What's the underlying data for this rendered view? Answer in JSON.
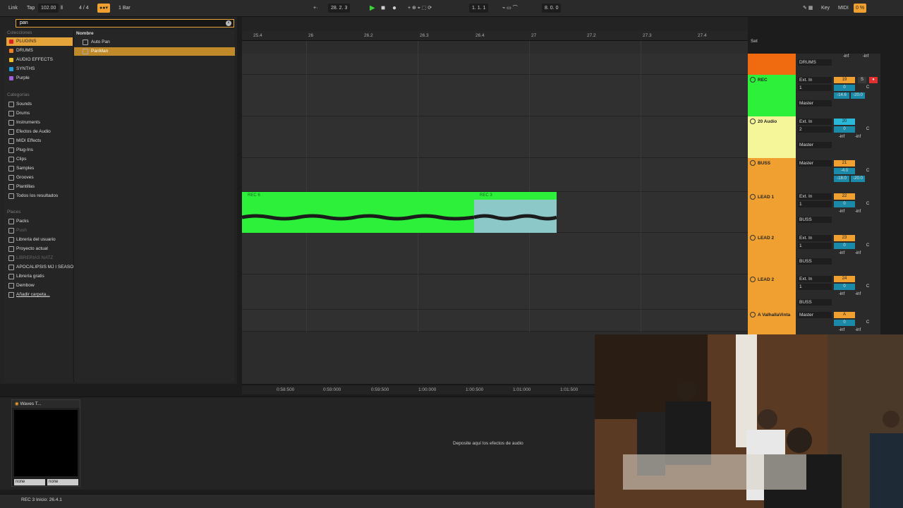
{
  "topbar": {
    "link": "Link",
    "tap": "Tap",
    "tempo": "102.00",
    "signature": "4 / 4",
    "quantize": "1 Bar",
    "position": "28.  2.  3",
    "loop_start": "1.  1.  1",
    "loop_length": "8.  0.  0",
    "key": "Key",
    "midi": "MIDI",
    "cpu": "0 %"
  },
  "browser": {
    "search": "pan",
    "collections_header": "Colecciones",
    "collections": [
      {
        "label": "PLUGINS",
        "color": "#e02020"
      },
      {
        "label": "DRUMS",
        "color": "#f08020"
      },
      {
        "label": "AUDIO EFFECTS",
        "color": "#f0c020"
      },
      {
        "label": "SYNTHS",
        "color": "#20a0e0"
      },
      {
        "label": "Purple",
        "color": "#a060e0"
      }
    ],
    "categories_header": "Categorías",
    "categories": [
      "Sounds",
      "Drums",
      "Instruments",
      "Efectos de Audio",
      "MIDI Effects",
      "Plug-Ins",
      "Clips",
      "Samples",
      "Grooves",
      "Plantillas",
      "Todos los resultados"
    ],
    "places_header": "Places",
    "places": [
      "Packs",
      "Push",
      "Librería del usuario",
      "Proyecto actual",
      "LIBRERIAS NATZ",
      "APOCALIPSIS MJ I SEASO",
      "Librería gratis",
      "Dembow",
      "Añadir carpeta..."
    ],
    "list_header": "Nombre",
    "items": [
      "Auto Pan",
      "PanMan"
    ]
  },
  "ruler": [
    "25.4",
    "26",
    "26.2",
    "26.3",
    "26.4",
    "27",
    "27.2",
    "27.3",
    "27.4"
  ],
  "set_label": "Set",
  "timeline": [
    "0:58:500",
    "0:59:000",
    "0:59:500",
    "1:00:000",
    "1:00:500",
    "1:01:000",
    "1:01:500"
  ],
  "clips": {
    "a": "REC 6",
    "b": "REC 3"
  },
  "tracks": [
    {
      "name": "",
      "color": "#f06a10",
      "in": "Ext. In",
      "ch": "",
      "out": "DRUMS",
      "num": "",
      "vol": "",
      "pan": "",
      "c": "-inf",
      "d": "-inf"
    },
    {
      "name": "REC",
      "color": "#2cf03a",
      "in": "Ext. In",
      "ch": "1",
      "out": "Master",
      "num": "19",
      "vol": "0",
      "pan": "C",
      "c": "-14.6",
      "d": "-20.0"
    },
    {
      "name": "20 Audio",
      "color": "#f5f59a",
      "in": "Ext. In",
      "ch": "2",
      "out": "Master",
      "num": "20",
      "vol": "0",
      "pan": "C",
      "c": "-inf",
      "d": "-inf"
    },
    {
      "name": "BUSS",
      "color": "#f0a030",
      "in": "Master",
      "ch": "",
      "out": "",
      "num": "21",
      "vol": "-4.0",
      "pan": "C",
      "c": "-18.0",
      "d": "-20.0"
    },
    {
      "name": "LEAD 1",
      "color": "#f0a030",
      "in": "Ext. In",
      "ch": "1",
      "out": "BUSS",
      "num": "22",
      "vol": "0",
      "pan": "C",
      "c": "-inf",
      "d": "-inf"
    },
    {
      "name": "LEAD 2",
      "color": "#f0a030",
      "in": "Ext. In",
      "ch": "1",
      "out": "BUSS",
      "num": "23",
      "vol": "0",
      "pan": "C",
      "c": "-inf",
      "d": "-inf"
    },
    {
      "name": "LEAD 2",
      "color": "#f0a030",
      "in": "Ext. In",
      "ch": "1",
      "out": "BUSS",
      "num": "24",
      "vol": "0",
      "pan": "C",
      "c": "-inf",
      "d": "-inf"
    },
    {
      "name": "A ValhallaVinta",
      "color": "#f0a030",
      "in": "Master",
      "ch": "",
      "out": "",
      "num": "A",
      "vol": "0",
      "pan": "C",
      "c": "-inf",
      "d": "-inf"
    }
  ],
  "mixer_labels": {
    "in": "In",
    "auto": "Auto",
    "off": "Off"
  },
  "device": {
    "name": "Waves T...",
    "sel1": "none",
    "sel2": "none",
    "drop": "Deposite aquí los efectos de audio"
  },
  "status": "REC 3  Inicio: 26.4.1"
}
